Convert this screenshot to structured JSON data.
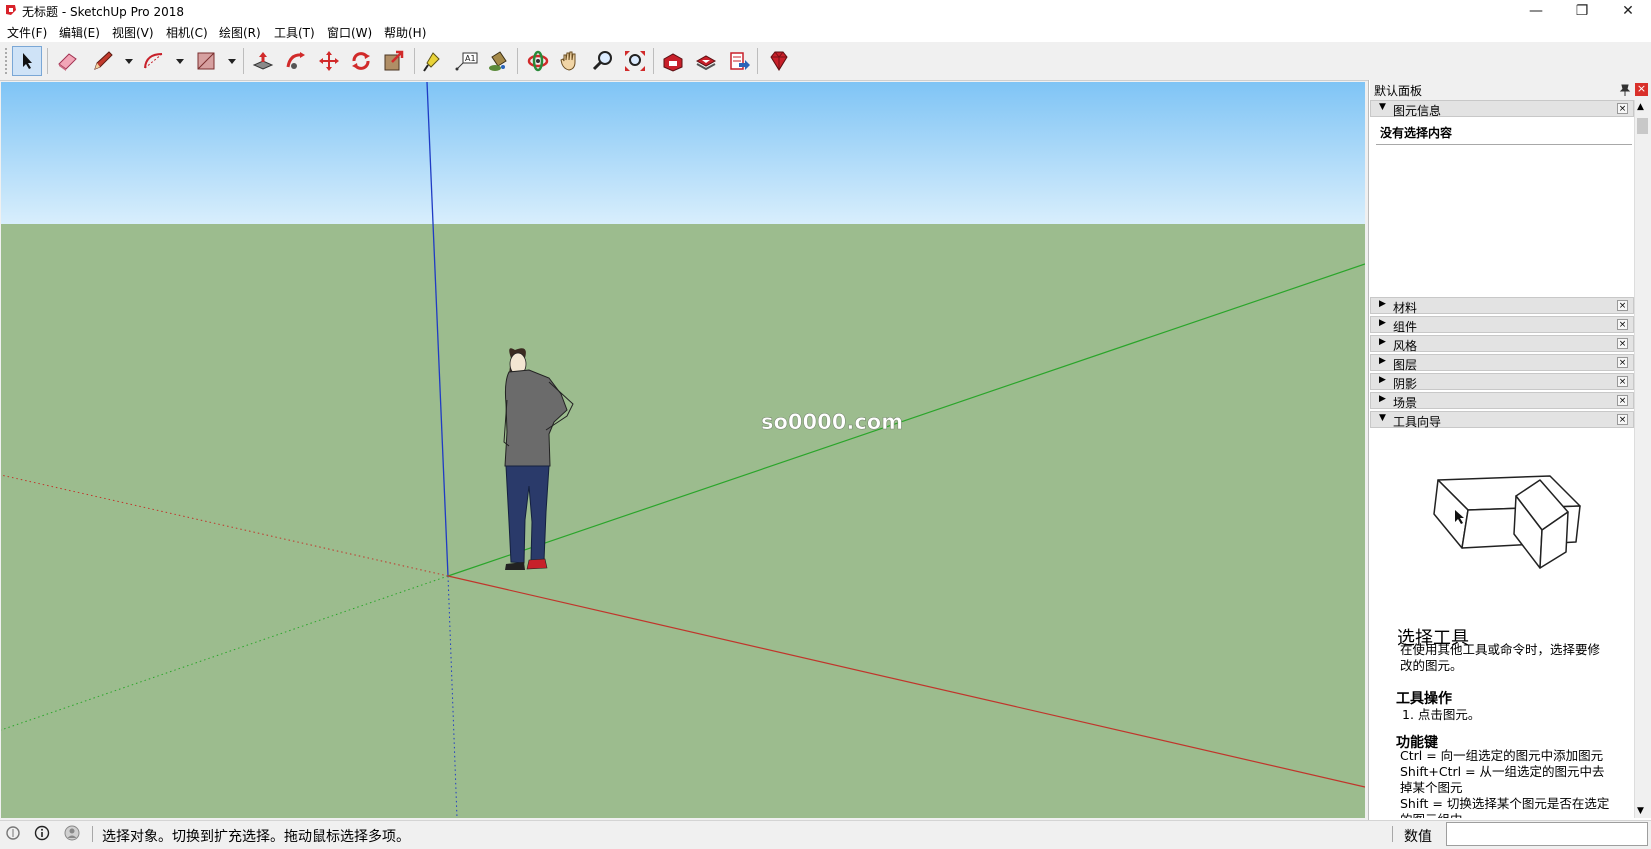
{
  "window": {
    "title": "无标题 - SketchUp Pro 2018",
    "minimize_glyph": "—",
    "maximize_glyph": "❐",
    "close_glyph": "✕"
  },
  "menu": [
    {
      "label": "文件(F)"
    },
    {
      "label": "编辑(E)"
    },
    {
      "label": "视图(V)"
    },
    {
      "label": "相机(C)"
    },
    {
      "label": "绘图(R)"
    },
    {
      "label": "工具(T)"
    },
    {
      "label": "窗口(W)"
    },
    {
      "label": "帮助(H)"
    }
  ],
  "toolbar": {
    "tools": [
      {
        "icon": "select-arrow-icon",
        "active": true
      },
      {
        "icon": "eraser-icon"
      },
      {
        "icon": "pencil-line-icon",
        "has_dropdown": true
      },
      {
        "icon": "arc-icon",
        "has_dropdown": true
      },
      {
        "icon": "rectangle-icon",
        "has_dropdown": true
      },
      {
        "icon": "push-pull-icon"
      },
      {
        "icon": "follow-me-icon"
      },
      {
        "icon": "move-icon"
      },
      {
        "icon": "rotate-icon"
      },
      {
        "icon": "scale-icon"
      },
      {
        "icon": "tape-measure-icon"
      },
      {
        "icon": "text-label-icon"
      },
      {
        "icon": "paint-bucket-icon"
      },
      {
        "icon": "orbit-icon"
      },
      {
        "icon": "pan-hand-icon"
      },
      {
        "icon": "zoom-icon"
      },
      {
        "icon": "zoom-extents-icon"
      },
      {
        "icon": "warehouse-icon"
      },
      {
        "icon": "extension-warehouse-icon"
      },
      {
        "icon": "share-model-icon"
      },
      {
        "icon": "ruby-gem-icon"
      }
    ]
  },
  "viewport": {
    "watermark": "so0000.com",
    "sky_color": "#88c8f4",
    "ground_color": "#9cbc8e",
    "axis_colors": {
      "red": "#c0352b",
      "green": "#2aa52a",
      "blue": "#1f3bc4"
    }
  },
  "tray": {
    "title": "默认面板",
    "pin_glyph": "📌",
    "close_glyph": "×",
    "entity_info": {
      "title": "图元信息",
      "content": "没有选择内容"
    },
    "panels": [
      {
        "label": "材料",
        "expanded": false
      },
      {
        "label": "组件",
        "expanded": false
      },
      {
        "label": "风格",
        "expanded": false
      },
      {
        "label": "图层",
        "expanded": false
      },
      {
        "label": "阴影",
        "expanded": false
      },
      {
        "label": "场景",
        "expanded": false
      },
      {
        "label": "工具向导",
        "expanded": true
      }
    ],
    "instructor": {
      "tool_name": "选择工具",
      "description": "在使用其他工具或命令时，选择要修改的图元。",
      "operation_heading": "工具操作",
      "operation_step": "1. 点击图元。",
      "modifier_heading": "功能键",
      "modifiers": [
        "Ctrl = 向一组选定的图元中添加图元",
        "Shift+Ctrl = 从一组选定的图元中去掉某个图元",
        "Shift = 切换选择某个图元是否在选定的图元组中"
      ]
    }
  },
  "status": {
    "message": "选择对象。切换到扩充选择。拖动鼠标选择多项。",
    "value_label": "数值",
    "value": ""
  }
}
